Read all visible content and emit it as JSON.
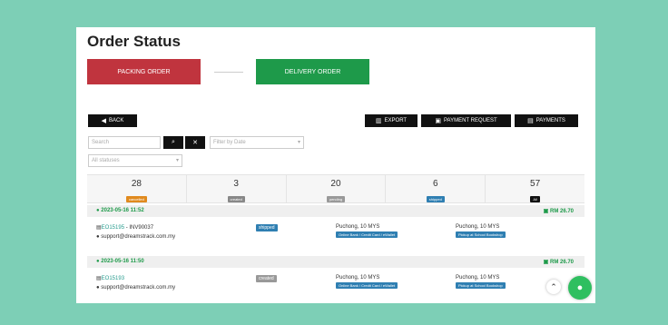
{
  "page": {
    "title": "Order Status"
  },
  "steps": {
    "packing": "PACKING ORDER",
    "delivery": "DELIVERY ORDER"
  },
  "toolbar": {
    "back": "BACK",
    "export": "EXPORT",
    "payment_request": "PAYMENT REQUEST",
    "payments": "PAYMENTS"
  },
  "filters": {
    "search_placeholder": "Search",
    "search_glyph": "⌕",
    "clear_glyph": "✕",
    "date_placeholder": "Filter by Date",
    "status_placeholder": "All statuses"
  },
  "stats": [
    {
      "count": "28",
      "label": "cancelled",
      "color": "#e08a1e"
    },
    {
      "count": "3",
      "label": "created",
      "color": "#888888"
    },
    {
      "count": "20",
      "label": "pending",
      "color": "#999999"
    },
    {
      "count": "6",
      "label": "shipped",
      "color": "#2f7fb2"
    },
    {
      "count": "57",
      "label": "All",
      "color": "#111111"
    }
  ],
  "groups": [
    {
      "datetime": "2023-05-16 11:52",
      "amount": "RM 26.70",
      "order": {
        "ref_id": "EO15195",
        "ref_suffix": " - INV90037",
        "email": "support@dreamstrack.com.my",
        "status": "shipped",
        "status_color": "#2f7fb2",
        "from_location": "Puchong, 10 MYS",
        "from_tag": "Online Bank / Credit Card / eWallet",
        "to_location": "Puchong, 10 MYS",
        "to_tag": "Pickup at School Bookshop"
      }
    },
    {
      "datetime": "2023-05-16 11:50",
      "amount": "RM 26.70",
      "order": {
        "ref_id": "EO15193",
        "ref_suffix": "",
        "email": "support@dreamstrack.com.my",
        "status": "created",
        "status_color": "#999999",
        "from_location": "Puchong, 10 MYS",
        "from_tag": "Online Bank / Credit Card / eWallet",
        "to_location": "Puchong, 10 MYS",
        "to_tag": "Pickup at School Bookshop"
      }
    }
  ]
}
